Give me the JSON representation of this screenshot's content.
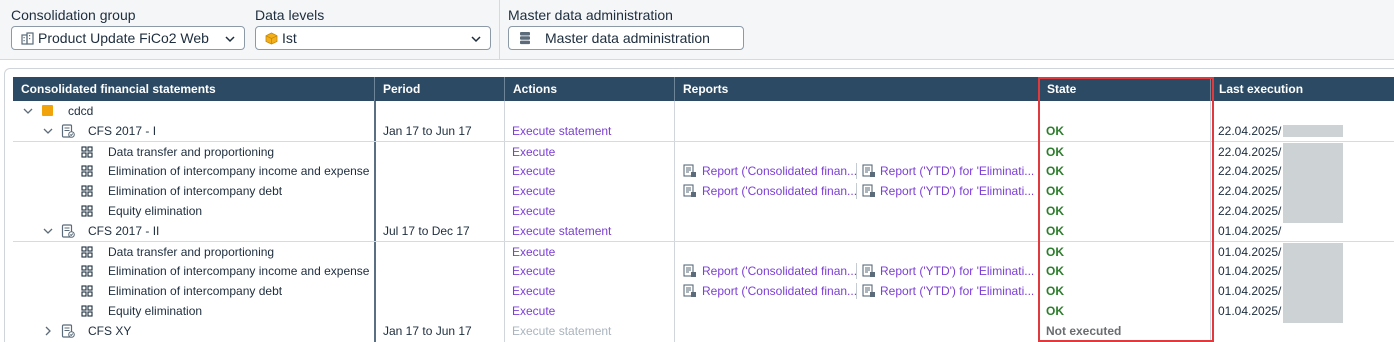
{
  "toolbar": {
    "consolidation_group_label": "Consolidation group",
    "consolidation_group_value": "Product Update FiCo2 Web",
    "data_levels_label": "Data levels",
    "data_levels_value": "Ist",
    "master_data_label": "Master data administration",
    "master_data_button": "Master data administration"
  },
  "table": {
    "columns": [
      "Consolidated financial statements",
      "Period",
      "Actions",
      "Reports",
      "State",
      "Last execution"
    ],
    "group": {
      "name": "cdcd",
      "color": "#f0a30a"
    },
    "statements": [
      {
        "name": "CFS 2017 - I",
        "period": "Jan 17 to Jun 17",
        "action": "Execute statement",
        "state": "OK",
        "last_execution": "22.04.2025/",
        "expanded": true,
        "steps": [
          {
            "name": "Data transfer and proportioning",
            "action": "Execute",
            "report1": "",
            "report2": "",
            "state": "OK",
            "last_execution": "22.04.2025/"
          },
          {
            "name": "Elimination of intercompany income and expense",
            "action": "Execute",
            "report1": "Report ('Consolidated finan...",
            "report2": "Report ('YTD') for 'Eliminati...",
            "state": "OK",
            "last_execution": "22.04.2025/"
          },
          {
            "name": "Elimination of intercompany debt",
            "action": "Execute",
            "report1": "Report ('Consolidated finan...",
            "report2": "Report ('YTD') for 'Eliminati...",
            "state": "OK",
            "last_execution": "22.04.2025/"
          },
          {
            "name": "Equity elimination",
            "action": "Execute",
            "report1": "",
            "report2": "",
            "state": "OK",
            "last_execution": "22.04.2025/"
          }
        ]
      },
      {
        "name": "CFS 2017 - II",
        "period": "Jul 17 to Dec 17",
        "action": "Execute statement",
        "state": "OK",
        "last_execution": "01.04.2025/",
        "expanded": true,
        "steps": [
          {
            "name": "Data transfer and proportioning",
            "action": "Execute",
            "report1": "",
            "report2": "",
            "state": "OK",
            "last_execution": "01.04.2025/"
          },
          {
            "name": "Elimination of intercompany income and expense",
            "action": "Execute",
            "report1": "Report ('Consolidated finan...",
            "report2": "Report ('YTD') for 'Eliminati...",
            "state": "OK",
            "last_execution": "01.04.2025/"
          },
          {
            "name": "Elimination of intercompany debt",
            "action": "Execute",
            "report1": "Report ('Consolidated finan...",
            "report2": "Report ('YTD') for 'Eliminati...",
            "state": "OK",
            "last_execution": "01.04.2025/"
          },
          {
            "name": "Equity elimination",
            "action": "Execute",
            "report1": "",
            "report2": "",
            "state": "OK",
            "last_execution": "01.04.2025/"
          }
        ]
      },
      {
        "name": "CFS XY",
        "period": "Jan 17 to Jun 17",
        "action": "Execute statement",
        "state": "Not executed",
        "last_execution": "",
        "expanded": false,
        "steps": []
      }
    ]
  },
  "colors": {
    "header_bg": "#2c4a63",
    "link": "#7c3ed4",
    "ok": "#2b7d2b",
    "highlight": "#e0393e"
  },
  "icons": {
    "consolidation_group": "building-icon",
    "data_levels": "cube-icon",
    "master_data": "database-icon",
    "statement": "document-check-icon",
    "step": "grid-icon",
    "report": "report-icon"
  }
}
